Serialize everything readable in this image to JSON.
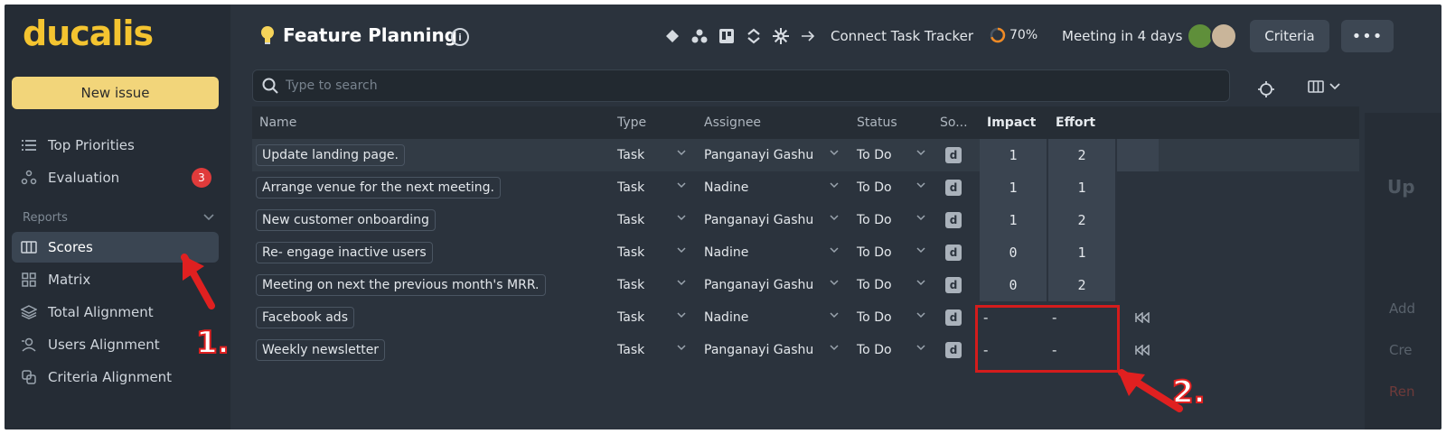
{
  "sidebar": {
    "logo": "ducalis",
    "new_issue": "New issue",
    "items": [
      {
        "label": "Top Priorities"
      },
      {
        "label": "Evaluation",
        "badge": "3"
      }
    ],
    "reports_label": "Reports",
    "report_items": [
      {
        "label": "Scores"
      },
      {
        "label": "Matrix"
      },
      {
        "label": "Total Alignment"
      },
      {
        "label": "Users Alignment"
      },
      {
        "label": "Criteria Alignment"
      }
    ]
  },
  "header": {
    "title": "Feature Planning",
    "info": "i",
    "connect": "Connect Task Tracker",
    "progress": "70%",
    "meeting": "Meeting in 4 days",
    "criteria": "Criteria",
    "more": "•••"
  },
  "search": {
    "placeholder": "Type to search"
  },
  "table": {
    "columns": [
      "Name",
      "Type",
      "Assignee",
      "Status",
      "So...",
      "Impact",
      "Effort"
    ],
    "rows": [
      {
        "name": "Update landing page.",
        "type": "Task",
        "assignee": "Panganayi Gashu",
        "status": "To Do",
        "source": "d",
        "impact": "1",
        "effort": "2"
      },
      {
        "name": "Arrange venue for the next meeting.",
        "type": "Task",
        "assignee": "Nadine",
        "status": "To Do",
        "source": "d",
        "impact": "1",
        "effort": "1"
      },
      {
        "name": "New customer onboarding",
        "type": "Task",
        "assignee": "Panganayi Gashu",
        "status": "To Do",
        "source": "d",
        "impact": "1",
        "effort": "2"
      },
      {
        "name": "Re- engage inactive users",
        "type": "Task",
        "assignee": "Nadine",
        "status": "To Do",
        "source": "d",
        "impact": "0",
        "effort": "1"
      },
      {
        "name": "Meeting on next the previous month's MRR.",
        "type": "Task",
        "assignee": "Panganayi Gashu",
        "status": "To Do",
        "source": "d",
        "impact": "0",
        "effort": "2"
      },
      {
        "name": "Facebook ads",
        "type": "Task",
        "assignee": "Nadine",
        "status": "To Do",
        "source": "d",
        "impact": "-",
        "effort": "-"
      },
      {
        "name": "Weekly newsletter",
        "type": "Task",
        "assignee": "Panganayi Gashu",
        "status": "To Do",
        "source": "d",
        "impact": "-",
        "effort": "-"
      }
    ]
  },
  "annotations": {
    "one": "1.",
    "two": "2."
  },
  "right_panel": {
    "t1": "Up",
    "t2": "Add",
    "t3": "Cre",
    "t4": "Ren"
  },
  "colors": {
    "accent": "#f4c430",
    "badge": "#e03b3b",
    "annotation": "#d41c1c"
  }
}
